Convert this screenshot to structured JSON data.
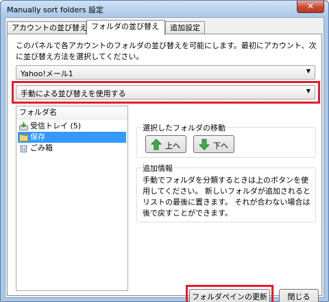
{
  "window": {
    "title": "Manually sort folders 設定",
    "close_glyph": "✕"
  },
  "tabs": [
    {
      "label": "アカウントの並び替え"
    },
    {
      "label": "フォルダの並び替え"
    },
    {
      "label": "追加設定"
    }
  ],
  "description": "このパネルで各アカウントのフォルダの並び替えを可能にします。最初にアカウント、次に並び替え方法を選択してください。",
  "account_select": {
    "value": "Yahoo!メール1"
  },
  "sort_method_select": {
    "value": "手動による並び替えを使用する"
  },
  "folder_tree": {
    "header": "フォルダ名",
    "items": [
      {
        "label": "受信トレイ (5)",
        "icon": "inbox-icon"
      },
      {
        "label": "保存",
        "icon": "folder-icon"
      },
      {
        "label": "ごみ箱",
        "icon": "trash-icon"
      }
    ]
  },
  "move_group": {
    "title": "選択したフォルダの移動",
    "up_label": "上へ",
    "down_label": "下へ",
    "accent": "#2e9e3f"
  },
  "info_group": {
    "title": "追加情報",
    "text": "手動でフォルダを分類するときは上のボタンを使用してください。 新しいフォルダが追加されるとリストの最後に置きます。 それが合わない場合は後で戻すことができます。"
  },
  "buttons": {
    "refresh": "フォルダペインの更新",
    "close": "閉じる"
  },
  "colors": {
    "highlight": "#e8192c",
    "selection": "#3399ff"
  }
}
